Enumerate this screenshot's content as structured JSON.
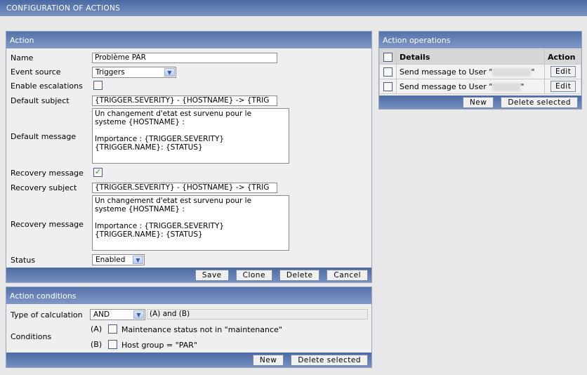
{
  "page_title": "CONFIGURATION OF ACTIONS",
  "action": {
    "title": "Action",
    "name_label": "Name",
    "name_value": "Problème PAR",
    "event_source_label": "Event source",
    "event_source_value": "Triggers",
    "escalations_label": "Enable escalations",
    "default_subject_label": "Default subject",
    "default_subject_value": "{TRIGGER.SEVERITY} - {HOSTNAME} -> {TRIG",
    "default_message_label": "Default message",
    "message_lines": [
      "Un changement d'etat est survenu pour le",
      "systeme {HOSTNAME} :",
      "",
      "Importance : {TRIGGER.SEVERITY}",
      "{TRIGGER.NAME}: {STATUS}"
    ],
    "recovery_message_label": "Recovery message",
    "recovery_subject_label": "Recovery subject",
    "recovery_subject_value": "{TRIGGER.SEVERITY} - {HOSTNAME} -> {TRIG",
    "recovery_message_text_label": "Recovery message",
    "status_label": "Status",
    "status_value": "Enabled",
    "buttons": {
      "save": "Save",
      "clone": "Clone",
      "delete": "Delete",
      "cancel": "Cancel"
    }
  },
  "conditions": {
    "title": "Action conditions",
    "calc_label": "Type of calculation",
    "calc_value": "AND",
    "calc_formula": "(A) and (B)",
    "conditions_label": "Conditions",
    "items": [
      {
        "id": "(A)",
        "text": "Maintenance status not in \"maintenance\""
      },
      {
        "id": "(B)",
        "text": "Host group = \"PAR\""
      }
    ],
    "buttons": {
      "new": "New",
      "delete_selected": "Delete selected"
    }
  },
  "operations": {
    "title": "Action operations",
    "col_details": "Details",
    "col_action": "Action",
    "rows": [
      {
        "prefix": "Send message to User \"",
        "suffix": "\"",
        "edit": "Edit"
      },
      {
        "prefix": "Send message to User \"",
        "suffix": "\"",
        "edit": "Edit"
      }
    ],
    "buttons": {
      "new": "New",
      "delete_selected": "Delete selected"
    }
  }
}
